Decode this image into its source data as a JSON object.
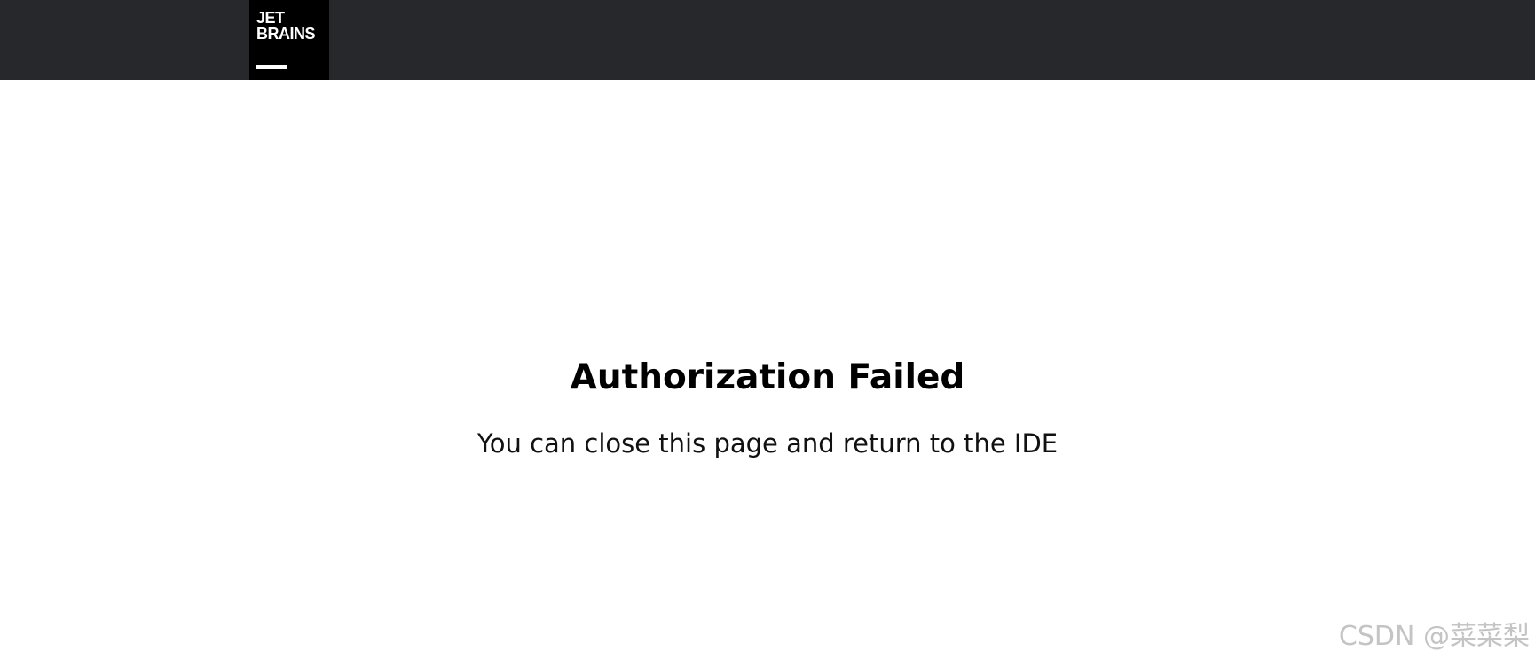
{
  "header": {
    "logo": {
      "line1": "JET",
      "line2": "BRAINS"
    }
  },
  "main": {
    "title": "Authorization Failed",
    "message": "You can close this page and return to the IDE"
  },
  "watermark": "CSDN @菜菜梨",
  "colors": {
    "header_bg": "#27282c",
    "logo_bg": "#000000",
    "logo_fg": "#ffffff",
    "page_bg": "#ffffff",
    "text": "#000000",
    "watermark": "#c4c4c4"
  }
}
